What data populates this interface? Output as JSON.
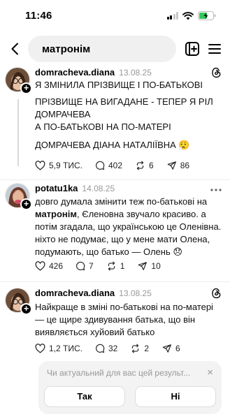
{
  "status_bar": {
    "time": "11:46"
  },
  "search": {
    "query": "матронім"
  },
  "posts": [
    {
      "username": "domracheva.diana",
      "date": "13.08.25",
      "paragraphs": [
        "Я ЗМІНИЛА ПРІЗВИЩЕ І ПО-БАТЬКОВІ",
        "ПРІЗВИЩЕ НА ВИГАДАНЕ - ТЕПЕР Я РІЛ ДОМРАЧЕВА",
        "А ПО-БАТЬКОВІ НА ПО-МАТЕРІ",
        "ДОМРАЧЕВА ДІАНА НАТАЛІЇВНА 😮‍💨"
      ],
      "likes": "5,9 ТИС.",
      "replies": "402",
      "reposts": "6",
      "shares": "86"
    },
    {
      "username": "potatu1ka",
      "date": "14.08.25",
      "text_before": "довго думала змінити теж по-батькові на ",
      "text_bold": "матронім",
      "text_after": ", Єленовна звучало красиво. а потім згадала, що українською це Оленівна. ніхто не подумає, що у мене мати Олена, подумають, що батько — Олень 😞",
      "likes": "426",
      "replies": "7",
      "reposts": "1",
      "shares": "10"
    },
    {
      "username": "domracheva.diana",
      "date": "13.08.25",
      "text": "Найкраще в зміні по-батькові на по-матері — це щире здивування батька, що він виявляється хуйовий батько",
      "likes": "1,2 ТИС.",
      "replies": "32",
      "reposts": "2",
      "shares": "6"
    }
  ],
  "feedback": {
    "question": "Чи актуальний для вас цей результ...",
    "close": "×",
    "yes": "Так",
    "no": "Ні"
  },
  "icons": {
    "back": "chevron-left-icon",
    "add": "add-square-icon",
    "menu": "hamburger-menu-icon",
    "threads": "threads-logo-icon",
    "more": "more-dots-icon",
    "like": "heart-icon",
    "reply": "comment-icon",
    "repost": "repost-icon",
    "share": "send-icon"
  }
}
